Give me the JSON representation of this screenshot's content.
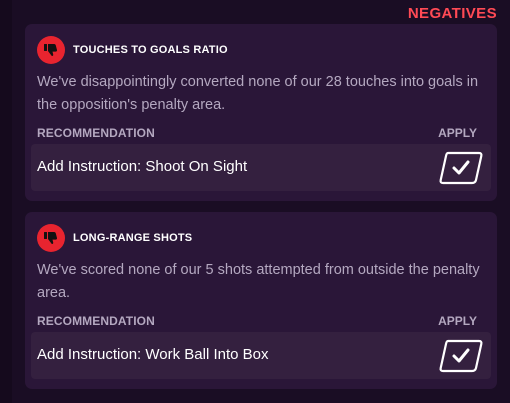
{
  "section": {
    "title": "NEGATIVES"
  },
  "cards": [
    {
      "title": "TOUCHES TO GOALS RATIO",
      "description": "We've disappointingly converted none of our 28 touches into goals in the opposition's penalty area.",
      "recommendation_label": "RECOMMENDATION",
      "apply_label": "APPLY",
      "recommendation": "Add Instruction: Shoot On Sight",
      "applied": true
    },
    {
      "title": "LONG-RANGE SHOTS",
      "description": "We've scored none of our 5 shots attempted from outside the penalty area.",
      "recommendation_label": "RECOMMENDATION",
      "apply_label": "APPLY",
      "recommendation": "Add Instruction: Work Ball Into Box",
      "applied": true
    }
  ],
  "icons": {
    "badge": "thumbs-down-icon",
    "apply": "checkmark-icon"
  },
  "colors": {
    "accent": "#ff4a55",
    "badge": "#e8242f",
    "card": "#2a1638",
    "background": "#1a0d24"
  }
}
